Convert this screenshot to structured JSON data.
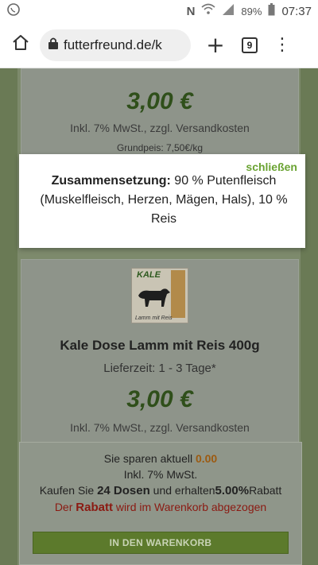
{
  "status_bar": {
    "time": "07:37",
    "battery": "89%"
  },
  "browser": {
    "url": "futterfreund.de/k",
    "tab_count": "9"
  },
  "card_top": {
    "price": "3,00 €",
    "tax_note": "Inkl. 7% MwSt., zzgl. Versandkosten",
    "base_price": "Grundpeis: 7,50€/kg"
  },
  "popup": {
    "close_label": "schließen",
    "label": "Zusammensetzung:",
    "text": " 90 % Putenfleisch (Muskelfleisch, Herzen, Mägen, Hals), 10 % Reis"
  },
  "product": {
    "image_brand": "KALE",
    "image_caption": "Lamm mit Reis",
    "title": "Kale Dose Lamm mit Reis 400g",
    "delivery": "Lieferzeit: 1 - 3 Tage*",
    "price": "3,00 €",
    "tax_note": "Inkl. 7% MwSt., zzgl. Versandkosten"
  },
  "discount_bar": {
    "savings_prefix": "Sie sparen aktuell ",
    "savings_value": "0.00",
    "tax": "Inkl. 7% MwSt.",
    "buy_prefix": "Kaufen Sie ",
    "buy_qty": "24 Dosen",
    "buy_mid": " und erhalten",
    "buy_pct": "5.00%",
    "buy_suffix": "Rabatt",
    "rebate_prefix": "Der ",
    "rebate_word": "Rabatt",
    "rebate_suffix": " wird im Warenkorb abgezogen",
    "cart_button": "IN DEN WARENKORB"
  }
}
